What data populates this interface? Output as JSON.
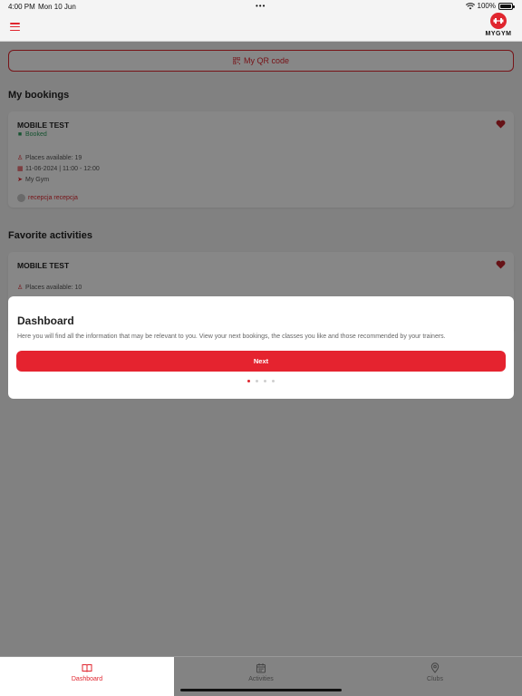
{
  "status_bar": {
    "time": "4:00 PM",
    "date": "Mon 10 Jun",
    "battery": "100%"
  },
  "app": {
    "logo_text": "MYGYM"
  },
  "qr_button": {
    "label": "My QR code"
  },
  "bookings": {
    "heading": "My bookings",
    "card": {
      "name": "MOBILE TEST",
      "status": "Booked",
      "places": "Places available: 19",
      "datetime": "11-06-2024 | 11:00 - 12:00",
      "location": "My Gym",
      "trainer": "recepcja recepcja"
    }
  },
  "favorites": {
    "heading": "Favorite activities",
    "card": {
      "name": "MOBILE TEST",
      "places": "Places available: 10"
    }
  },
  "tutorial": {
    "title": "Dashboard",
    "description": "Here you will find all the information that may be relevant to you. View your next bookings, the classes you like and those recommended by your trainers.",
    "next_label": "Next",
    "step": 1,
    "steps_total": 4
  },
  "tabs": [
    {
      "label": "Dashboard",
      "icon": "book-open-icon",
      "active": true
    },
    {
      "label": "Activities",
      "icon": "calendar-icon",
      "active": false
    },
    {
      "label": "Clubs",
      "icon": "location-pin-icon",
      "active": false
    }
  ],
  "colors": {
    "accent": "#e0262f",
    "success": "#2a9d5c",
    "overlay": "rgba(0,0,0,0.47)"
  }
}
